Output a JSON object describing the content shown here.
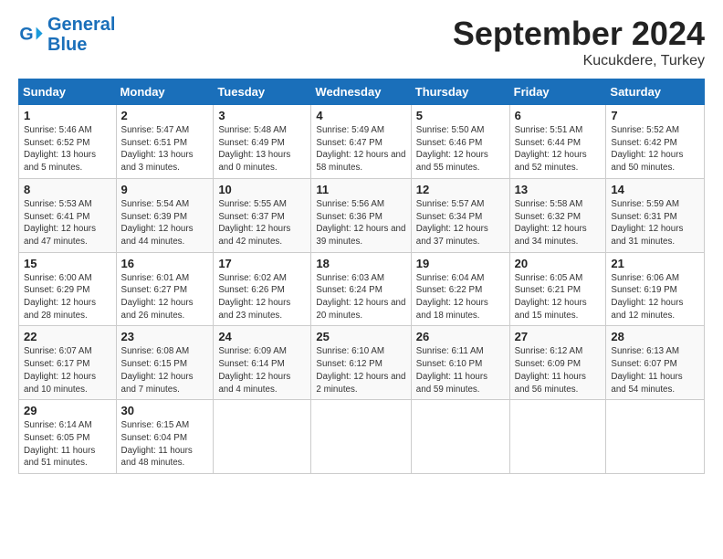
{
  "header": {
    "logo_general": "General",
    "logo_blue": "Blue",
    "month": "September 2024",
    "location": "Kucukdere, Turkey"
  },
  "weekdays": [
    "Sunday",
    "Monday",
    "Tuesday",
    "Wednesday",
    "Thursday",
    "Friday",
    "Saturday"
  ],
  "weeks": [
    [
      {
        "day": "1",
        "sunrise": "5:46 AM",
        "sunset": "6:52 PM",
        "daylight": "13 hours and 5 minutes."
      },
      {
        "day": "2",
        "sunrise": "5:47 AM",
        "sunset": "6:51 PM",
        "daylight": "13 hours and 3 minutes."
      },
      {
        "day": "3",
        "sunrise": "5:48 AM",
        "sunset": "6:49 PM",
        "daylight": "13 hours and 0 minutes."
      },
      {
        "day": "4",
        "sunrise": "5:49 AM",
        "sunset": "6:47 PM",
        "daylight": "12 hours and 58 minutes."
      },
      {
        "day": "5",
        "sunrise": "5:50 AM",
        "sunset": "6:46 PM",
        "daylight": "12 hours and 55 minutes."
      },
      {
        "day": "6",
        "sunrise": "5:51 AM",
        "sunset": "6:44 PM",
        "daylight": "12 hours and 52 minutes."
      },
      {
        "day": "7",
        "sunrise": "5:52 AM",
        "sunset": "6:42 PM",
        "daylight": "12 hours and 50 minutes."
      }
    ],
    [
      {
        "day": "8",
        "sunrise": "5:53 AM",
        "sunset": "6:41 PM",
        "daylight": "12 hours and 47 minutes."
      },
      {
        "day": "9",
        "sunrise": "5:54 AM",
        "sunset": "6:39 PM",
        "daylight": "12 hours and 44 minutes."
      },
      {
        "day": "10",
        "sunrise": "5:55 AM",
        "sunset": "6:37 PM",
        "daylight": "12 hours and 42 minutes."
      },
      {
        "day": "11",
        "sunrise": "5:56 AM",
        "sunset": "6:36 PM",
        "daylight": "12 hours and 39 minutes."
      },
      {
        "day": "12",
        "sunrise": "5:57 AM",
        "sunset": "6:34 PM",
        "daylight": "12 hours and 37 minutes."
      },
      {
        "day": "13",
        "sunrise": "5:58 AM",
        "sunset": "6:32 PM",
        "daylight": "12 hours and 34 minutes."
      },
      {
        "day": "14",
        "sunrise": "5:59 AM",
        "sunset": "6:31 PM",
        "daylight": "12 hours and 31 minutes."
      }
    ],
    [
      {
        "day": "15",
        "sunrise": "6:00 AM",
        "sunset": "6:29 PM",
        "daylight": "12 hours and 28 minutes."
      },
      {
        "day": "16",
        "sunrise": "6:01 AM",
        "sunset": "6:27 PM",
        "daylight": "12 hours and 26 minutes."
      },
      {
        "day": "17",
        "sunrise": "6:02 AM",
        "sunset": "6:26 PM",
        "daylight": "12 hours and 23 minutes."
      },
      {
        "day": "18",
        "sunrise": "6:03 AM",
        "sunset": "6:24 PM",
        "daylight": "12 hours and 20 minutes."
      },
      {
        "day": "19",
        "sunrise": "6:04 AM",
        "sunset": "6:22 PM",
        "daylight": "12 hours and 18 minutes."
      },
      {
        "day": "20",
        "sunrise": "6:05 AM",
        "sunset": "6:21 PM",
        "daylight": "12 hours and 15 minutes."
      },
      {
        "day": "21",
        "sunrise": "6:06 AM",
        "sunset": "6:19 PM",
        "daylight": "12 hours and 12 minutes."
      }
    ],
    [
      {
        "day": "22",
        "sunrise": "6:07 AM",
        "sunset": "6:17 PM",
        "daylight": "12 hours and 10 minutes."
      },
      {
        "day": "23",
        "sunrise": "6:08 AM",
        "sunset": "6:15 PM",
        "daylight": "12 hours and 7 minutes."
      },
      {
        "day": "24",
        "sunrise": "6:09 AM",
        "sunset": "6:14 PM",
        "daylight": "12 hours and 4 minutes."
      },
      {
        "day": "25",
        "sunrise": "6:10 AM",
        "sunset": "6:12 PM",
        "daylight": "12 hours and 2 minutes."
      },
      {
        "day": "26",
        "sunrise": "6:11 AM",
        "sunset": "6:10 PM",
        "daylight": "11 hours and 59 minutes."
      },
      {
        "day": "27",
        "sunrise": "6:12 AM",
        "sunset": "6:09 PM",
        "daylight": "11 hours and 56 minutes."
      },
      {
        "day": "28",
        "sunrise": "6:13 AM",
        "sunset": "6:07 PM",
        "daylight": "11 hours and 54 minutes."
      }
    ],
    [
      {
        "day": "29",
        "sunrise": "6:14 AM",
        "sunset": "6:05 PM",
        "daylight": "11 hours and 51 minutes."
      },
      {
        "day": "30",
        "sunrise": "6:15 AM",
        "sunset": "6:04 PM",
        "daylight": "11 hours and 48 minutes."
      },
      null,
      null,
      null,
      null,
      null
    ]
  ]
}
